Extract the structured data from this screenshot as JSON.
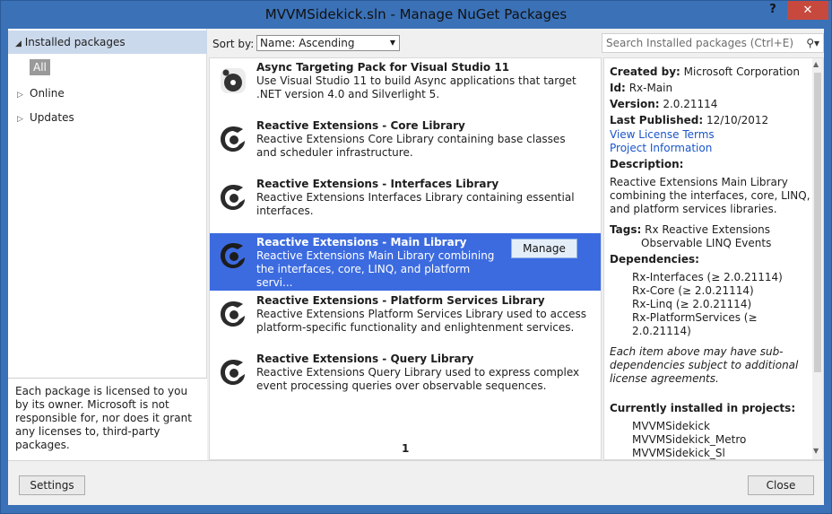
{
  "window": {
    "title": "MVVMSidekick.sln - Manage NuGet Packages",
    "help": "?",
    "close": "✕"
  },
  "sidebar": {
    "installed": "Installed packages",
    "all": "All",
    "online": "Online",
    "updates": "Updates",
    "license": "Each package is licensed to you by its owner. Microsoft is not responsible for, nor does it grant any licenses to, third-party packages."
  },
  "sort": {
    "label": "Sort by:",
    "value": "Name: Ascending"
  },
  "search": {
    "placeholder": "Search Installed packages (Ctrl+E)"
  },
  "packages": [
    {
      "title": "Async Targeting Pack for Visual Studio 11",
      "desc": "Use Visual Studio 11 to build Async applications that target .NET version 4.0 and Silverlight 5."
    },
    {
      "title": "Reactive Extensions - Core Library",
      "desc": "Reactive Extensions Core Library containing base classes and scheduler infrastructure."
    },
    {
      "title": "Reactive Extensions - Interfaces Library",
      "desc": "Reactive Extensions Interfaces Library containing essential interfaces."
    },
    {
      "title": "Reactive Extensions - Main Library",
      "desc": "Reactive Extensions Main Library combining the interfaces, core, LINQ, and platform servi...",
      "manage": "Manage"
    },
    {
      "title": "Reactive Extensions - Platform Services Library",
      "desc": "Reactive Extensions Platform Services Library used to access platform-specific functionality and enlightenment services."
    },
    {
      "title": "Reactive Extensions - Query Library",
      "desc": "Reactive Extensions Query Library used to express complex event processing queries over observable sequences."
    }
  ],
  "pager": "1",
  "details": {
    "created_by_label": "Created by:",
    "created_by": "Microsoft Corporation",
    "id_label": "Id:",
    "id": "Rx-Main",
    "version_label": "Version:",
    "version": "2.0.21114",
    "published_label": "Last Published:",
    "published": "12/10/2012",
    "license_link": "View License Terms",
    "project_link": "Project Information",
    "description_label": "Description:",
    "description_lines": [
      "Reactive Extensions Main Library",
      "combining the interfaces, core, LINQ,",
      "and platform services libraries."
    ],
    "tags_label": "Tags:",
    "tags_lines": [
      "Rx Reactive Extensions",
      "Observable LINQ Events"
    ],
    "deps_label": "Dependencies:",
    "deps_lines": [
      "Rx-Interfaces (≥ 2.0.21114)",
      "Rx-Core (≥ 2.0.21114)",
      "Rx-Linq (≥ 2.0.21114)",
      "Rx-PlatformServices (≥",
      "2.0.21114)"
    ],
    "note_lines": [
      "Each item above may have sub-",
      "dependencies subject to additional",
      "license agreements."
    ],
    "installed_label": "Currently installed in projects:",
    "projects": [
      "MVVMSidekick",
      "MVVMSidekick_Metro",
      "MVVMSidekick_Sl"
    ]
  },
  "footer": {
    "settings": "Settings",
    "close": "Close"
  }
}
